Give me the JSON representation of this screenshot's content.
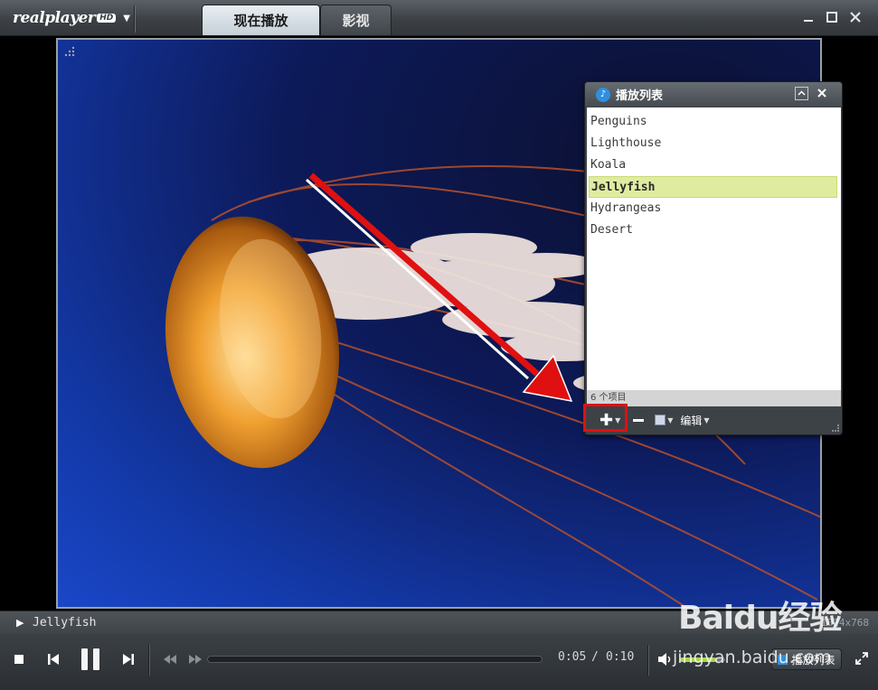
{
  "window": {
    "logo_text": "realplayer",
    "logo_badge": "HD",
    "tabs": [
      {
        "label": "现在播放",
        "active": true
      },
      {
        "label": "影视",
        "active": false
      }
    ]
  },
  "video": {
    "content": "Jellyfish"
  },
  "playlist": {
    "title": "播放列表",
    "items": [
      {
        "label": "Penguins",
        "selected": false
      },
      {
        "label": "Lighthouse",
        "selected": false
      },
      {
        "label": "Koala",
        "selected": false
      },
      {
        "label": "Jellyfish",
        "selected": true
      },
      {
        "label": "Hydrangeas",
        "selected": false
      },
      {
        "label": "Desert",
        "selected": false
      }
    ],
    "count_text": "6 个项目",
    "edit_label": "编辑"
  },
  "status": {
    "now_playing": "Jellyfish",
    "resolution": "1024x768"
  },
  "controls": {
    "time_current": "0:05",
    "time_separator": "/",
    "time_total": "0:10",
    "seek_progress": 0.0,
    "volume_level": 0.8,
    "playlist_button": "播放列表"
  },
  "watermark": {
    "brand": "Baidu经验",
    "url": "jingyan.baidu.com"
  },
  "colors": {
    "selected_row": "#dfeca0",
    "highlight_box": "#e01010",
    "accent_blue": "#2f8fe0",
    "volume_green": "#a8d64a"
  }
}
